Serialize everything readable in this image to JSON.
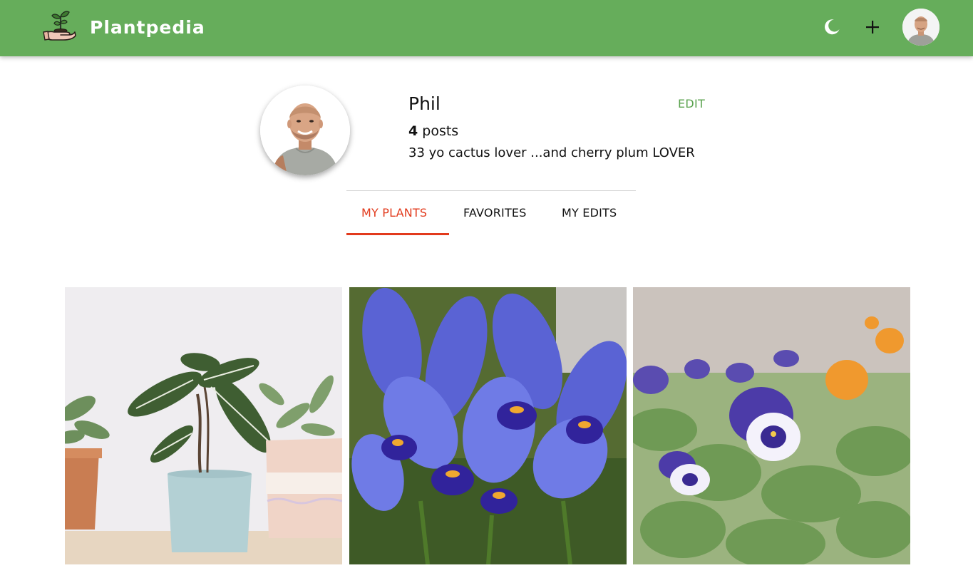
{
  "app": {
    "brand": "Plantpedia",
    "logo_icon": "hand-sprout-icon",
    "theme_icon": "moon-icon",
    "add_icon": "plus-icon",
    "user_icon": "user-avatar"
  },
  "colors": {
    "appbar": "#66ad5b",
    "accent": "#5aa24e",
    "active_tab": "#e23a1c"
  },
  "profile": {
    "name": "Phil",
    "edit_label": "EDIT",
    "posts_count": "4",
    "posts_label": " posts",
    "bio": "33 yo cactus lover ...and cherry plum LOVER"
  },
  "tabs": [
    {
      "label": "MY PLANTS",
      "active": true
    },
    {
      "label": "FAVORITES",
      "active": false
    },
    {
      "label": "MY EDITS",
      "active": false
    }
  ],
  "posts": [
    {
      "image": "potted-houseplants-photo"
    },
    {
      "image": "blue-iris-flowers-photo"
    },
    {
      "image": "pansy-flowers-photo"
    }
  ]
}
